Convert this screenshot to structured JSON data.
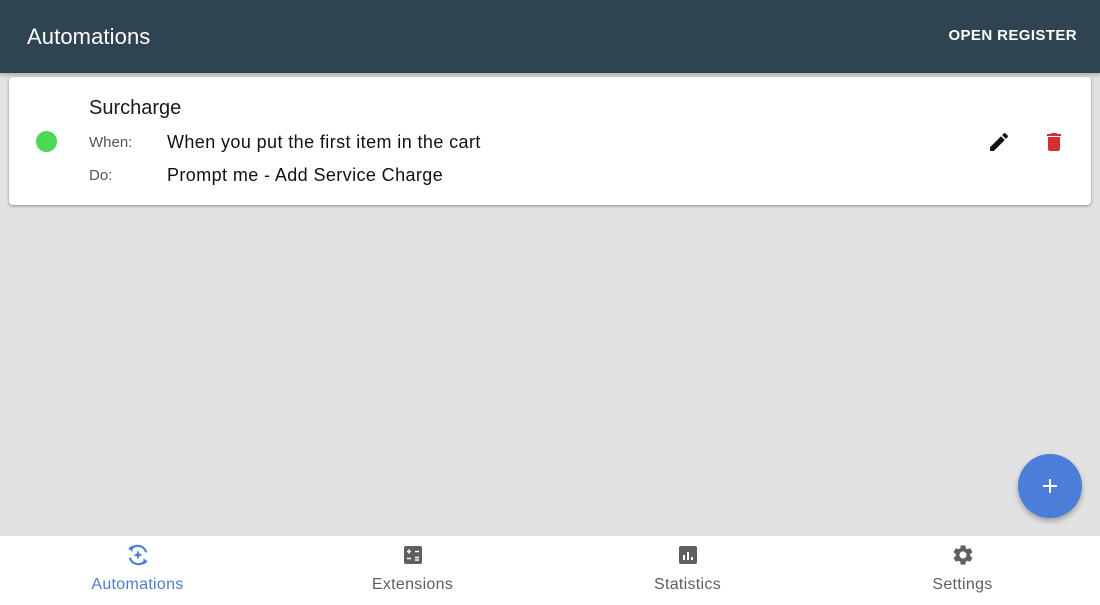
{
  "appbar": {
    "title": "Automations",
    "action_label": "OPEN REGISTER"
  },
  "automations": [
    {
      "title": "Surcharge",
      "status": "enabled",
      "status_color": "#4bd853",
      "when_label": "When:",
      "when_value": "When you put the first item in the cart",
      "do_label": "Do:",
      "do_value": "Prompt me - Add Service Charge",
      "edit_icon": "pencil-icon",
      "delete_icon": "trash-icon"
    }
  ],
  "fab": {
    "icon": "plus-icon",
    "color": "#4a7ed8"
  },
  "bottom_nav": {
    "active": 0,
    "items": [
      {
        "label": "Automations",
        "icon": "automations-icon"
      },
      {
        "label": "Extensions",
        "icon": "calculator-icon"
      },
      {
        "label": "Statistics",
        "icon": "bar-chart-icon"
      },
      {
        "label": "Settings",
        "icon": "gear-icon"
      }
    ]
  },
  "colors": {
    "appbar": "#2f4451",
    "accent": "#4a7ed8",
    "delete": "#d32f2f",
    "background": "#e2e2e2"
  }
}
